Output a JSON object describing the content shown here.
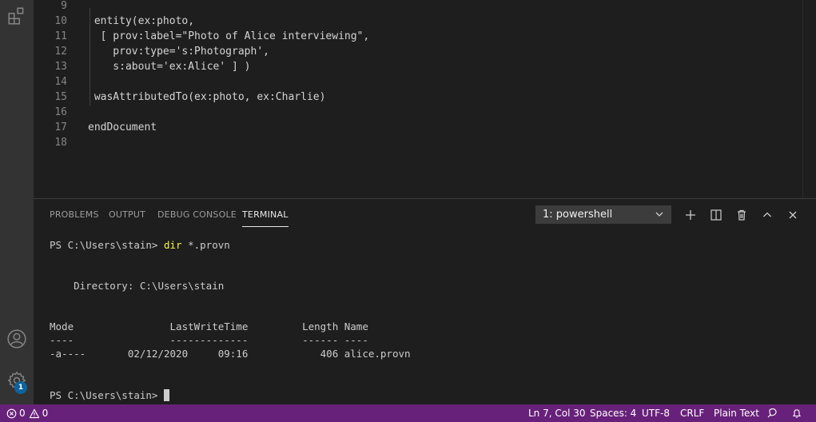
{
  "editor": {
    "lines": [
      {
        "num": "9",
        "text": ""
      },
      {
        "num": "10",
        "text": " entity(ex:photo,"
      },
      {
        "num": "11",
        "text": "  [ prov:label=\"Photo of Alice interviewing\","
      },
      {
        "num": "12",
        "text": "    prov:type='s:Photograph',"
      },
      {
        "num": "13",
        "text": "    s:about='ex:Alice' ] )"
      },
      {
        "num": "14",
        "text": ""
      },
      {
        "num": "15",
        "text": " wasAttributedTo(ex:photo, ex:Charlie)"
      },
      {
        "num": "16",
        "text": ""
      },
      {
        "num": "17",
        "text": "endDocument"
      },
      {
        "num": "18",
        "text": ""
      }
    ]
  },
  "panel": {
    "tabs": [
      "PROBLEMS",
      "OUTPUT",
      "DEBUG CONSOLE",
      "TERMINAL"
    ],
    "active_tab": "TERMINAL",
    "terminal_select": "1: powershell"
  },
  "terminal": {
    "prompt1": "PS C:\\Users\\stain> ",
    "command1": "dir",
    "command1_args": " *.provn",
    "directory": "    Directory: C:\\Users\\stain",
    "header": "Mode                LastWriteTime         Length Name",
    "separator": "----                -------------         ------ ----",
    "row": "-a----       02/12/2020     09:16            406 alice.provn",
    "prompt2": "PS C:\\Users\\stain> "
  },
  "status": {
    "errors": "0",
    "warnings": "0",
    "position": "Ln 7, Col 30",
    "spaces": "Spaces: 4",
    "encoding": "UTF-8",
    "eol": "CRLF",
    "language": "Plain Text"
  },
  "activity": {
    "accounts_badge": "1",
    "icons": [
      "extensions-icon",
      "account-icon",
      "settings-gear-icon"
    ]
  }
}
